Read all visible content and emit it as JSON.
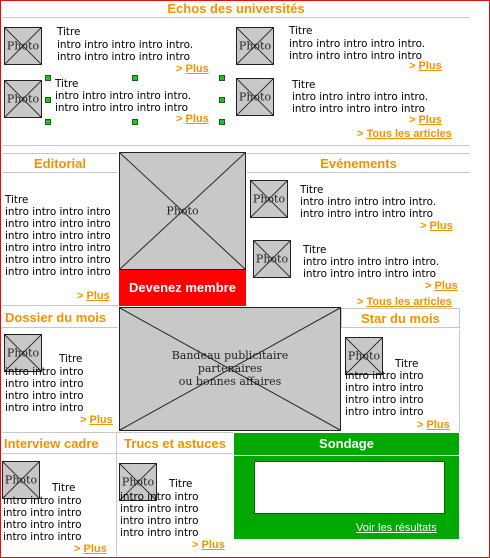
{
  "echos": {
    "title": "Echos des universités",
    "items": [
      {
        "photo": "Photo",
        "titre": "Titre",
        "intro1": "intro intro intro intro intro.",
        "intro2": "intro intro intro intro intro",
        "more": "Plus"
      },
      {
        "photo": "Photo",
        "titre": "Titre",
        "intro1": "intro intro intro intro intro.",
        "intro2": "intro intro intro intro intro",
        "more": "Plus"
      },
      {
        "photo": "Photo",
        "titre": "Titre",
        "intro1": "intro intro intro intro intro.",
        "intro2": "intro intro intro intro intro",
        "more": "Plus"
      },
      {
        "photo": "Photo",
        "titre": "Titre",
        "intro1": "intro intro intro intro intro.",
        "intro2": "intro intro intro intro intro",
        "more": "Plus"
      }
    ],
    "all_articles": "Tous les articles"
  },
  "editorial": {
    "title": "Editorial",
    "titre": "Titre",
    "lines": [
      "intro intro intro intro",
      "intro intro intro intro",
      "intro intro intro intro",
      "intro intro intro intro",
      "intro intro intro intro",
      "intro intro intro intro"
    ],
    "more": "Plus"
  },
  "center_photo": "Photo",
  "devenez": "Devenez membre",
  "evenements": {
    "title": "Evénements",
    "items": [
      {
        "photo": "Photo",
        "titre": "Titre",
        "intro1": "intro intro intro intro intro.",
        "intro2": "intro intro intro intro intro",
        "more": "Plus"
      },
      {
        "photo": "Photo",
        "titre": "Titre",
        "intro1": "intro intro intro intro intro.",
        "intro2": "intro intro intro intro intro",
        "more": "Plus"
      }
    ],
    "all_articles": "Tous les articles"
  },
  "dossier": {
    "title": "Dossier du mois",
    "photo": "Photo",
    "titre": "Titre",
    "lines": [
      "intro intro intro",
      "intro intro intro",
      "intro intro intro",
      "intro intro intro"
    ],
    "more": "Plus"
  },
  "bandeau": {
    "line1": "Bandeau publicitaire",
    "line2": "partenaires",
    "line3": "ou bonnes affaires"
  },
  "star": {
    "title": "Star du mois",
    "photo": "Photo",
    "titre": "Titre",
    "lines": [
      "intro intro intro",
      "intro intro intro",
      "intro intro intro",
      "intro intro intro"
    ],
    "more": "Plus"
  },
  "interview": {
    "title": "Interview cadre",
    "photo": "Photo",
    "titre": "Titre",
    "lines": [
      "intro intro intro",
      "intro intro intro",
      "intro intro intro",
      "intro intro intro"
    ],
    "more": "Plus"
  },
  "trucs": {
    "title": "Trucs et astuces",
    "photo": "Photo",
    "titre": "Titre",
    "lines": [
      "intro intro intro",
      "intro intro intro",
      "intro intro intro",
      "intro intro intro"
    ],
    "more": "Plus"
  },
  "sondage": {
    "title": "Sondage",
    "results": "Voir les résultats"
  },
  "colors": {
    "accent": "#f39200",
    "red": "#ff0000",
    "green": "#00a800",
    "photo_gray": "#c8c8c8"
  }
}
